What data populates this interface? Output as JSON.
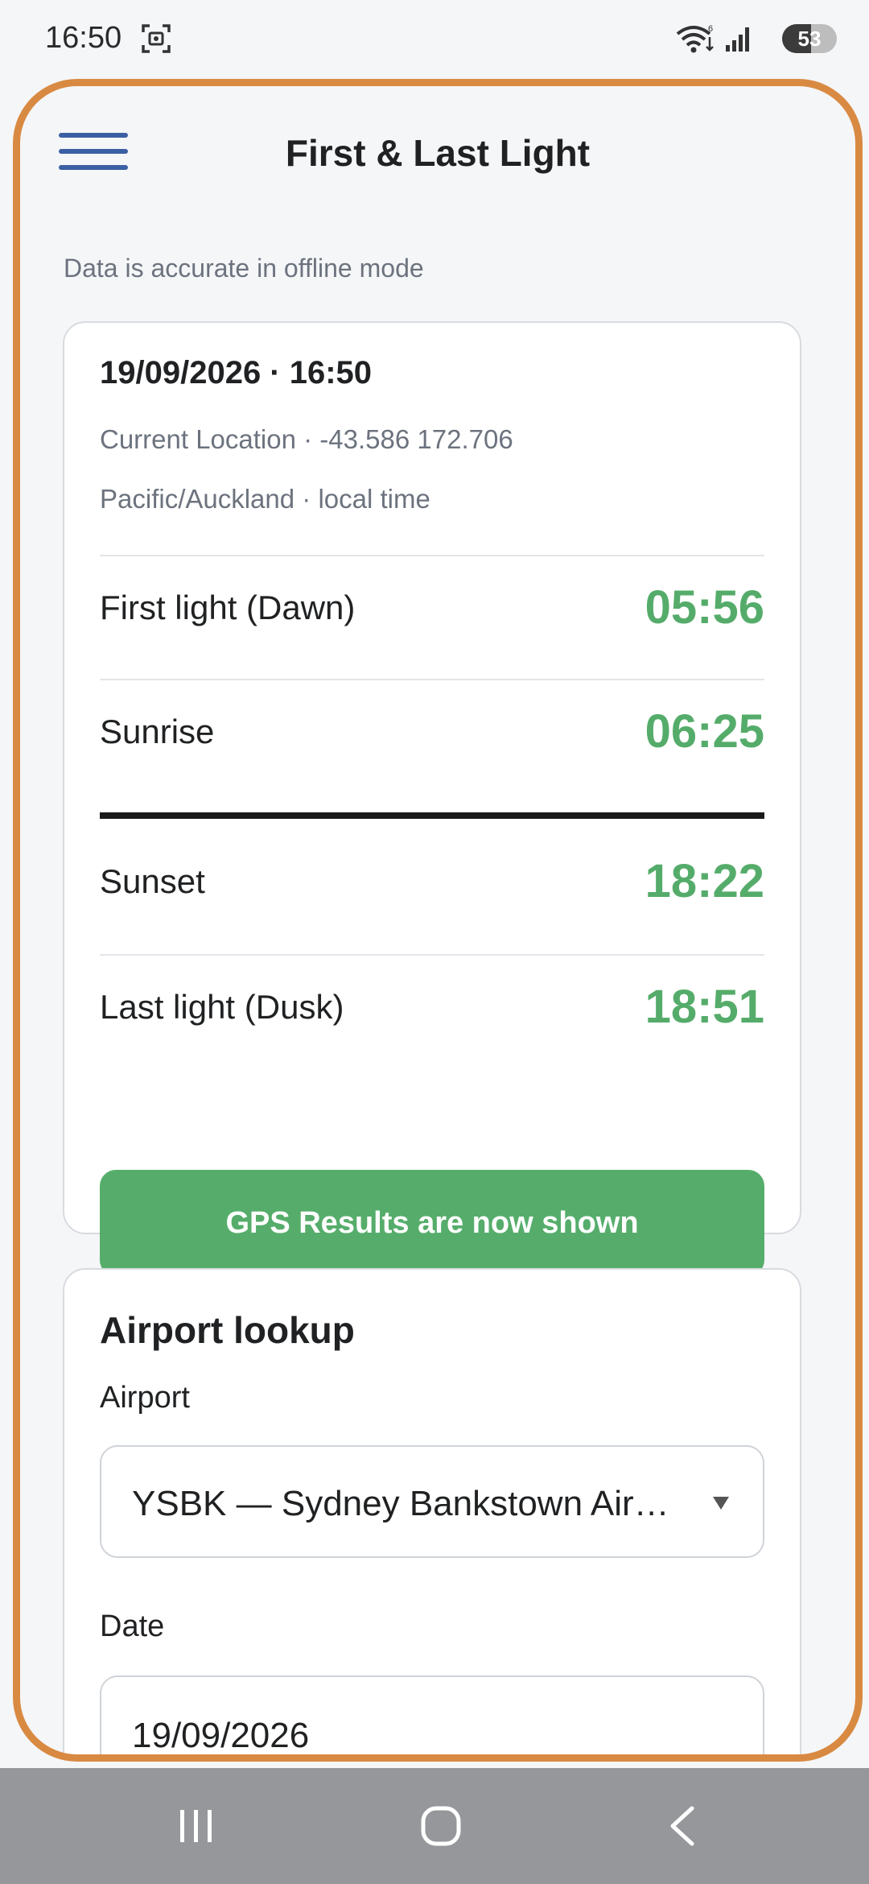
{
  "status_bar": {
    "time": "16:50",
    "battery": "53",
    "battery_level": 0.53,
    "icons": [
      "screenshot-icon",
      "wifi-icon",
      "signal-icon",
      "battery-icon"
    ]
  },
  "header": {
    "title": "First & Last Light",
    "menu_icon": "hamburger-menu-icon"
  },
  "offline_note": "Data is accurate in offline mode",
  "times_card": {
    "datetime": "19/09/2026 · 16:50",
    "location": "Current Location · -43.586  172.706",
    "timezone": "Pacific/Auckland · local time",
    "rows": [
      {
        "label": "First light (Dawn)",
        "value": "05:56"
      },
      {
        "label": "Sunrise",
        "value": "06:25"
      },
      {
        "label": "Sunset",
        "value": "18:22"
      },
      {
        "label": "Last light (Dusk)",
        "value": "18:51"
      }
    ],
    "gps_button": "GPS Results are now shown"
  },
  "airport_card": {
    "heading": "Airport lookup",
    "airport_label": "Airport",
    "airport_value": "YSBK — Sydney Bankstown Airport",
    "date_label": "Date",
    "date_value": "19/09/2026"
  },
  "colors": {
    "accent_green": "#55ac6a",
    "frame_orange": "#d98a42",
    "menu_blue": "#3b5fa3"
  },
  "nav_bar": {
    "icons": [
      "recents-icon",
      "home-icon",
      "back-icon"
    ]
  }
}
